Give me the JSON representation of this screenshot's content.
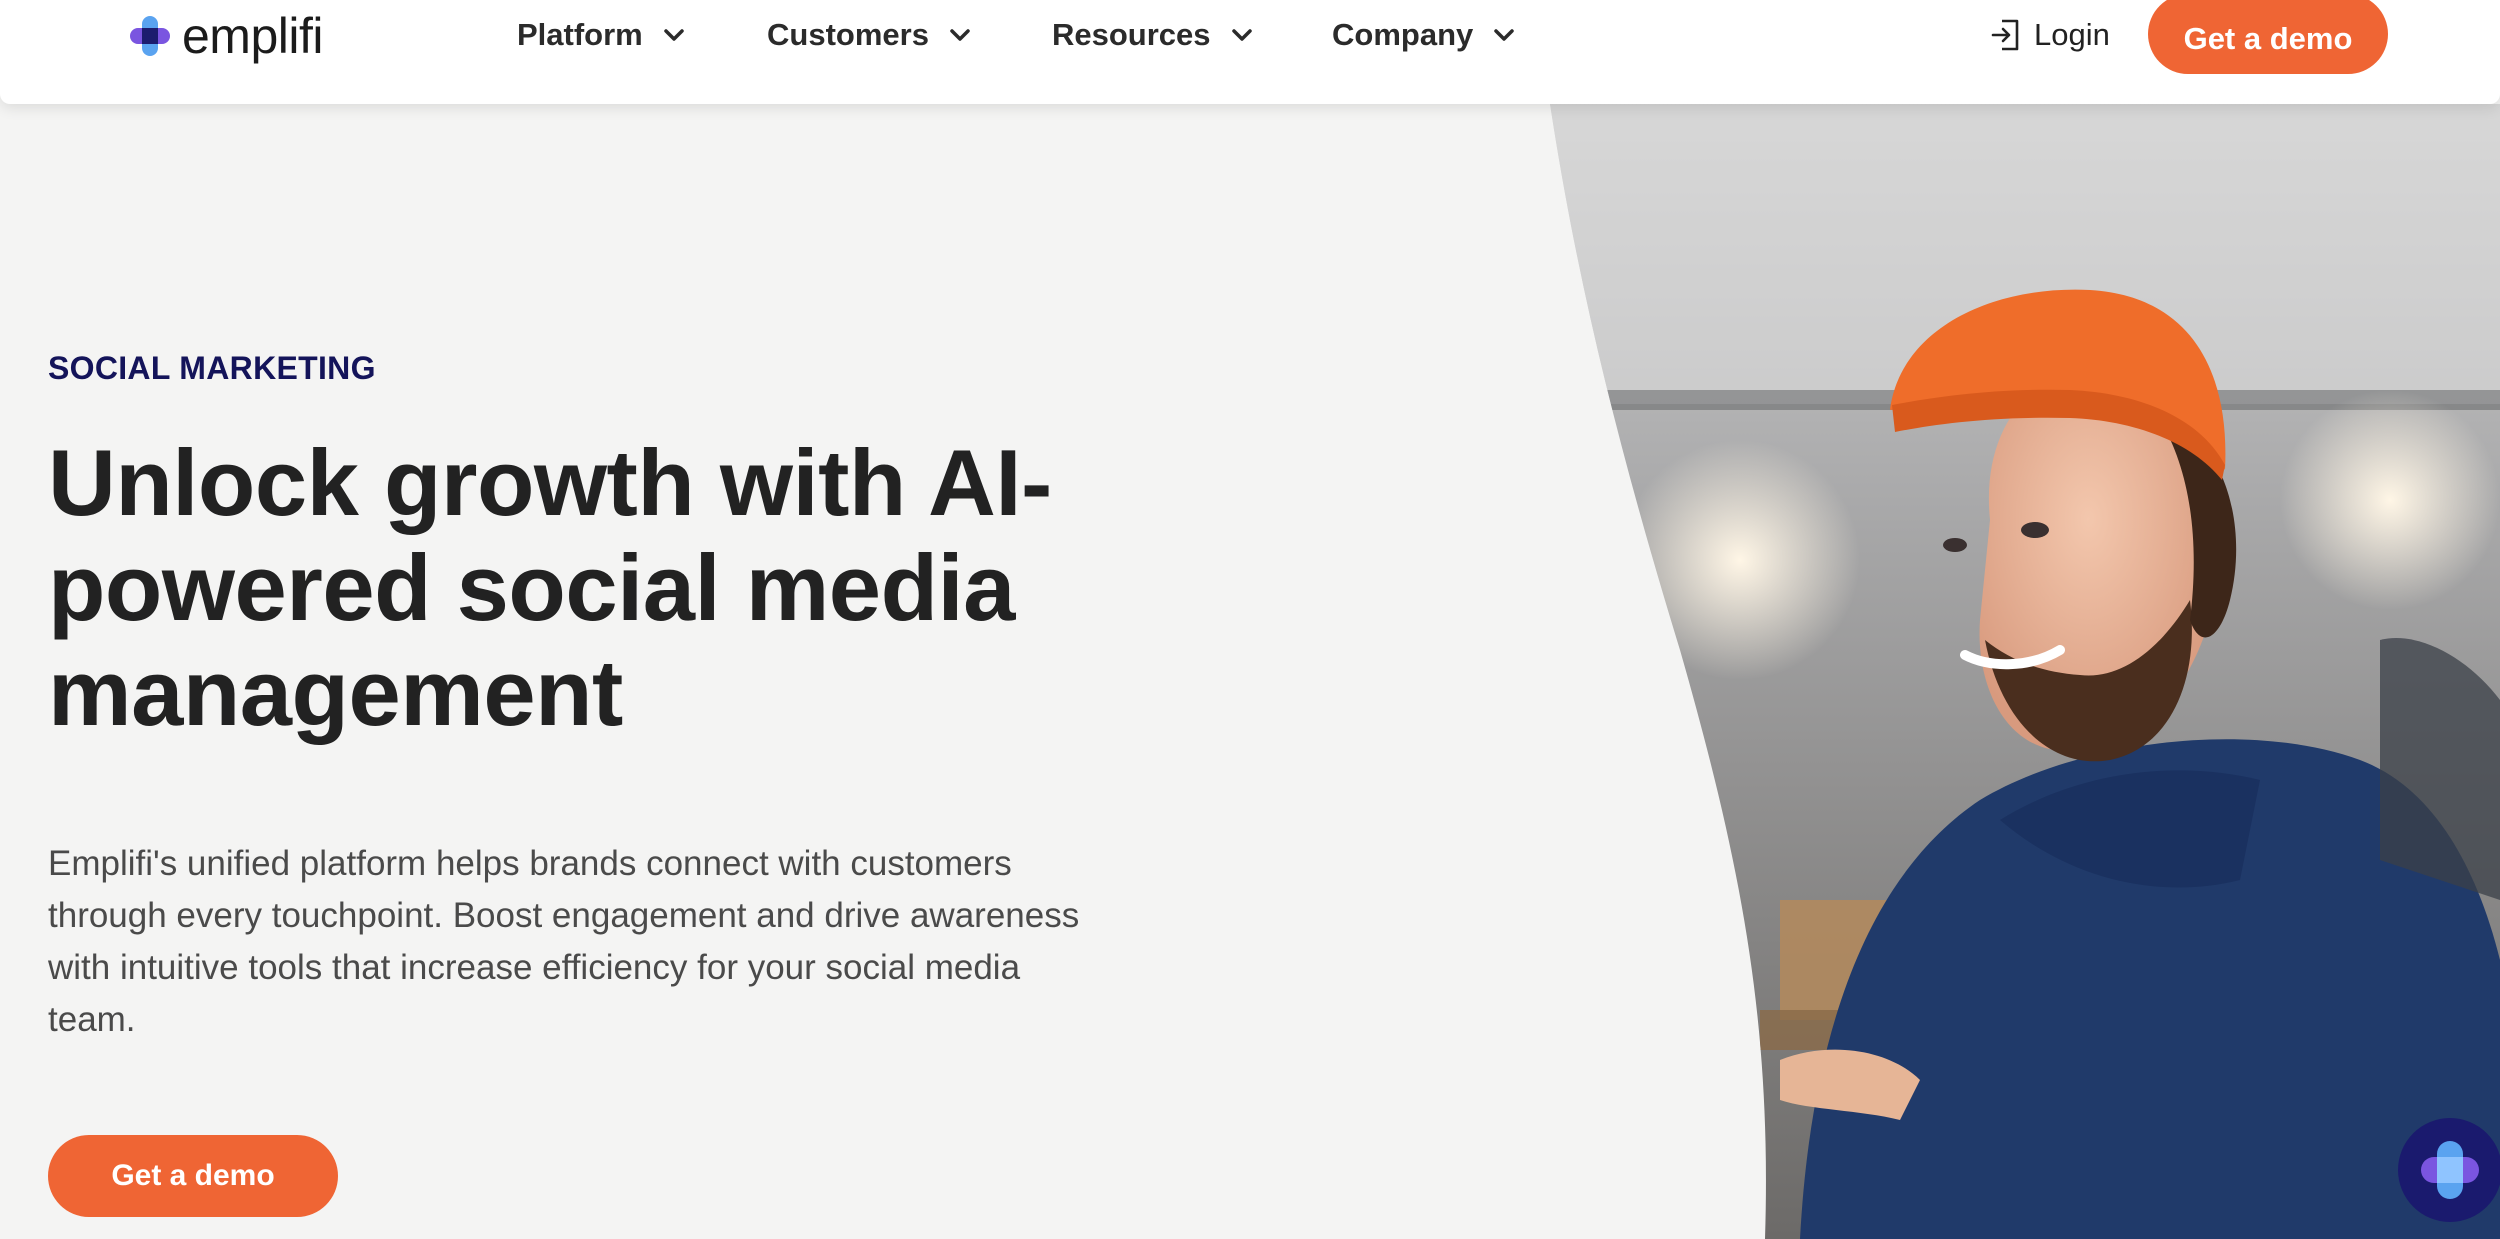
{
  "brand": {
    "name": "emplifi"
  },
  "nav": {
    "items": [
      {
        "label": "Platform"
      },
      {
        "label": "Customers"
      },
      {
        "label": "Resources"
      },
      {
        "label": "Company"
      }
    ],
    "login_label": "Login",
    "cta_label": "Get a demo"
  },
  "hero": {
    "eyebrow": "SOCIAL MARKETING",
    "headline_lines": [
      "Unlock growth with AI-",
      "powered social media",
      "management"
    ],
    "body_lines": [
      "Emplifi's unified platform helps brands connect with customers",
      "through every touchpoint. Boost engagement and drive awareness",
      "with intuitive tools that increase efficiency for your social media",
      "team."
    ],
    "cta_label": "Get a demo"
  },
  "icons": {
    "logo": "emplifi-logo-icon",
    "chevrons": "chevron-down-icon",
    "login": "login-icon",
    "chat": "chat-widget-icon"
  },
  "colors": {
    "accent": "#ef6534",
    "eyebrow": "#14145a",
    "background": "#f4f4f3",
    "chat": "#1a1a6e"
  }
}
